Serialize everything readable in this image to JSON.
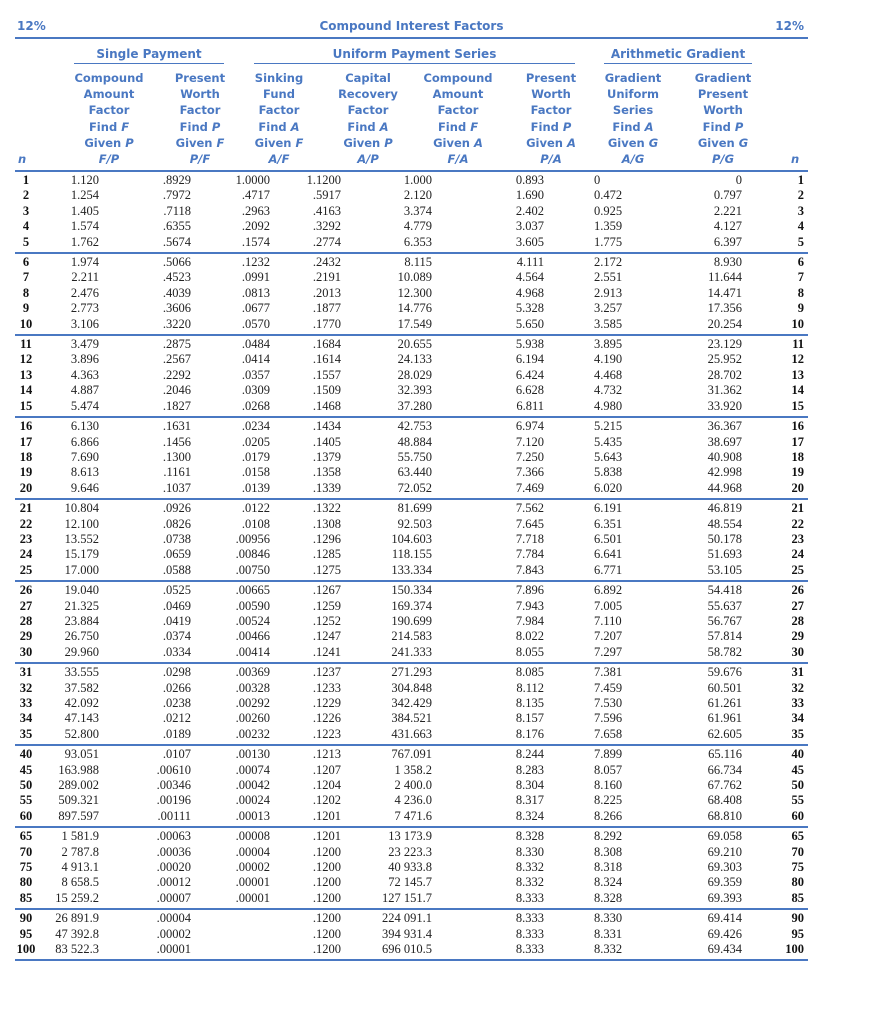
{
  "header": {
    "rate_left": "12%",
    "title": "Compound Interest Factors",
    "rate_right": "12%"
  },
  "groups": {
    "single_payment": "Single Payment",
    "uniform_series": "Uniform Payment Series",
    "arithmetic_gradient": "Arithmetic Gradient"
  },
  "columns": [
    {
      "key": "n",
      "lines": [],
      "symbol": "n"
    },
    {
      "key": "fp",
      "lines": [
        "Compound",
        "Amount",
        "Factor"
      ],
      "find": "F",
      "given": "P",
      "symbol": "F/P"
    },
    {
      "key": "pf",
      "lines": [
        "Present",
        "Worth",
        "Factor"
      ],
      "find": "P",
      "given": "F",
      "symbol": "P/F"
    },
    {
      "key": "af",
      "lines": [
        "Sinking",
        "Fund",
        "Factor"
      ],
      "find": "A",
      "given": "F",
      "symbol": "A/F"
    },
    {
      "key": "ap",
      "lines": [
        "Capital",
        "Recovery",
        "Factor"
      ],
      "find": "A",
      "given": "P",
      "symbol": "A/P"
    },
    {
      "key": "fa",
      "lines": [
        "Compound",
        "Amount",
        "Factor"
      ],
      "find": "F",
      "given": "A",
      "symbol": "F/A"
    },
    {
      "key": "pa",
      "lines": [
        "Present",
        "Worth",
        "Factor"
      ],
      "find": "P",
      "given": "A",
      "symbol": "P/A"
    },
    {
      "key": "ag",
      "lines": [
        "Gradient",
        "Uniform",
        "Series"
      ],
      "find": "A",
      "given": "G",
      "symbol": "A/G"
    },
    {
      "key": "pg",
      "lines": [
        "Gradient",
        "Present",
        "Worth"
      ],
      "find": "P",
      "given": "G",
      "symbol": "P/G"
    },
    {
      "key": "n2",
      "lines": [],
      "symbol": "n"
    }
  ],
  "find_word": "Find",
  "given_word": "Given",
  "row_groups": [
    [
      [
        "1",
        "1.120",
        ".8929",
        "1.0000",
        "1.1200",
        "1.000",
        "0.893",
        "0",
        "0"
      ],
      [
        "2",
        "1.254",
        ".7972",
        ".4717",
        ".5917",
        "2.120",
        "1.690",
        "0.472",
        "0.797"
      ],
      [
        "3",
        "1.405",
        ".7118",
        ".2963",
        ".4163",
        "3.374",
        "2.402",
        "0.925",
        "2.221"
      ],
      [
        "4",
        "1.574",
        ".6355",
        ".2092",
        ".3292",
        "4.779",
        "3.037",
        "1.359",
        "4.127"
      ],
      [
        "5",
        "1.762",
        ".5674",
        ".1574",
        ".2774",
        "6.353",
        "3.605",
        "1.775",
        "6.397"
      ]
    ],
    [
      [
        "6",
        "1.974",
        ".5066",
        ".1232",
        ".2432",
        "8.115",
        "4.111",
        "2.172",
        "8.930"
      ],
      [
        "7",
        "2.211",
        ".4523",
        ".0991",
        ".2191",
        "10.089",
        "4.564",
        "2.551",
        "11.644"
      ],
      [
        "8",
        "2.476",
        ".4039",
        ".0813",
        ".2013",
        "12.300",
        "4.968",
        "2.913",
        "14.471"
      ],
      [
        "9",
        "2.773",
        ".3606",
        ".0677",
        ".1877",
        "14.776",
        "5.328",
        "3.257",
        "17.356"
      ],
      [
        "10",
        "3.106",
        ".3220",
        ".0570",
        ".1770",
        "17.549",
        "5.650",
        "3.585",
        "20.254"
      ]
    ],
    [
      [
        "11",
        "3.479",
        ".2875",
        ".0484",
        ".1684",
        "20.655",
        "5.938",
        "3.895",
        "23.129"
      ],
      [
        "12",
        "3.896",
        ".2567",
        ".0414",
        ".1614",
        "24.133",
        "6.194",
        "4.190",
        "25.952"
      ],
      [
        "13",
        "4.363",
        ".2292",
        ".0357",
        ".1557",
        "28.029",
        "6.424",
        "4.468",
        "28.702"
      ],
      [
        "14",
        "4.887",
        ".2046",
        ".0309",
        ".1509",
        "32.393",
        "6.628",
        "4.732",
        "31.362"
      ],
      [
        "15",
        "5.474",
        ".1827",
        ".0268",
        ".1468",
        "37.280",
        "6.811",
        "4.980",
        "33.920"
      ]
    ],
    [
      [
        "16",
        "6.130",
        ".1631",
        ".0234",
        ".1434",
        "42.753",
        "6.974",
        "5.215",
        "36.367"
      ],
      [
        "17",
        "6.866",
        ".1456",
        ".0205",
        ".1405",
        "48.884",
        "7.120",
        "5.435",
        "38.697"
      ],
      [
        "18",
        "7.690",
        ".1300",
        ".0179",
        ".1379",
        "55.750",
        "7.250",
        "5.643",
        "40.908"
      ],
      [
        "19",
        "8.613",
        ".1161",
        ".0158",
        ".1358",
        "63.440",
        "7.366",
        "5.838",
        "42.998"
      ],
      [
        "20",
        "9.646",
        ".1037",
        ".0139",
        ".1339",
        "72.052",
        "7.469",
        "6.020",
        "44.968"
      ]
    ],
    [
      [
        "21",
        "10.804",
        ".0926",
        ".0122",
        ".1322",
        "81.699",
        "7.562",
        "6.191",
        "46.819"
      ],
      [
        "22",
        "12.100",
        ".0826",
        ".0108",
        ".1308",
        "92.503",
        "7.645",
        "6.351",
        "48.554"
      ],
      [
        "23",
        "13.552",
        ".0738",
        ".00956",
        ".1296",
        "104.603",
        "7.718",
        "6.501",
        "50.178"
      ],
      [
        "24",
        "15.179",
        ".0659",
        ".00846",
        ".1285",
        "118.155",
        "7.784",
        "6.641",
        "51.693"
      ],
      [
        "25",
        "17.000",
        ".0588",
        ".00750",
        ".1275",
        "133.334",
        "7.843",
        "6.771",
        "53.105"
      ]
    ],
    [
      [
        "26",
        "19.040",
        ".0525",
        ".00665",
        ".1267",
        "150.334",
        "7.896",
        "6.892",
        "54.418"
      ],
      [
        "27",
        "21.325",
        ".0469",
        ".00590",
        ".1259",
        "169.374",
        "7.943",
        "7.005",
        "55.637"
      ],
      [
        "28",
        "23.884",
        ".0419",
        ".00524",
        ".1252",
        "190.699",
        "7.984",
        "7.110",
        "56.767"
      ],
      [
        "29",
        "26.750",
        ".0374",
        ".00466",
        ".1247",
        "214.583",
        "8.022",
        "7.207",
        "57.814"
      ],
      [
        "30",
        "29.960",
        ".0334",
        ".00414",
        ".1241",
        "241.333",
        "8.055",
        "7.297",
        "58.782"
      ]
    ],
    [
      [
        "31",
        "33.555",
        ".0298",
        ".00369",
        ".1237",
        "271.293",
        "8.085",
        "7.381",
        "59.676"
      ],
      [
        "32",
        "37.582",
        ".0266",
        ".00328",
        ".1233",
        "304.848",
        "8.112",
        "7.459",
        "60.501"
      ],
      [
        "33",
        "42.092",
        ".0238",
        ".00292",
        ".1229",
        "342.429",
        "8.135",
        "7.530",
        "61.261"
      ],
      [
        "34",
        "47.143",
        ".0212",
        ".00260",
        ".1226",
        "384.521",
        "8.157",
        "7.596",
        "61.961"
      ],
      [
        "35",
        "52.800",
        ".0189",
        ".00232",
        ".1223",
        "431.663",
        "8.176",
        "7.658",
        "62.605"
      ]
    ],
    [
      [
        "40",
        "93.051",
        ".0107",
        ".00130",
        ".1213",
        "767.091",
        "8.244",
        "7.899",
        "65.116"
      ],
      [
        "45",
        "163.988",
        ".00610",
        ".00074",
        ".1207",
        "1 358.2",
        "8.283",
        "8.057",
        "66.734"
      ],
      [
        "50",
        "289.002",
        ".00346",
        ".00042",
        ".1204",
        "2 400.0",
        "8.304",
        "8.160",
        "67.762"
      ],
      [
        "55",
        "509.321",
        ".00196",
        ".00024",
        ".1202",
        "4 236.0",
        "8.317",
        "8.225",
        "68.408"
      ],
      [
        "60",
        "897.597",
        ".00111",
        ".00013",
        ".1201",
        "7 471.6",
        "8.324",
        "8.266",
        "68.810"
      ]
    ],
    [
      [
        "65",
        "1 581.9",
        ".00063",
        ".00008",
        ".1201",
        "13 173.9",
        "8.328",
        "8.292",
        "69.058"
      ],
      [
        "70",
        "2 787.8",
        ".00036",
        ".00004",
        ".1200",
        "23 223.3",
        "8.330",
        "8.308",
        "69.210"
      ],
      [
        "75",
        "4 913.1",
        ".00020",
        ".00002",
        ".1200",
        "40 933.8",
        "8.332",
        "8.318",
        "69.303"
      ],
      [
        "80",
        "8 658.5",
        ".00012",
        ".00001",
        ".1200",
        "72 145.7",
        "8.332",
        "8.324",
        "69.359"
      ],
      [
        "85",
        "15 259.2",
        ".00007",
        ".00001",
        ".1200",
        "127 151.7",
        "8.333",
        "8.328",
        "69.393"
      ]
    ],
    [
      [
        "90",
        "26 891.9",
        ".00004",
        "",
        ".1200",
        "224 091.1",
        "8.333",
        "8.330",
        "69.414"
      ],
      [
        "95",
        "47 392.8",
        ".00002",
        "",
        ".1200",
        "394 931.4",
        "8.333",
        "8.331",
        "69.426"
      ],
      [
        "100",
        "83 522.3",
        ".00001",
        "",
        ".1200",
        "696 010.5",
        "8.333",
        "8.332",
        "69.434"
      ]
    ]
  ],
  "colors": {
    "accent": "#4a78c2",
    "text": "#222222"
  }
}
